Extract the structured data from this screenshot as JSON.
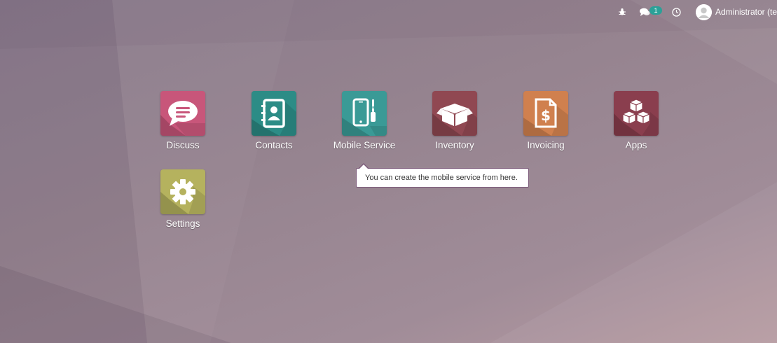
{
  "topbar": {
    "debug_icon": "bug-icon",
    "chat_icon": "chat-icon",
    "chat_badge": "1",
    "activity_icon": "clock-icon",
    "user_name": "Administrator (te"
  },
  "apps": [
    {
      "label": "Discuss",
      "icon": "chat-bubble-icon",
      "color": "#c8567a"
    },
    {
      "label": "Contacts",
      "icon": "address-book-icon",
      "color": "#2c8c86"
    },
    {
      "label": "Mobile Service",
      "icon": "mobile-phone-icon",
      "color": "#3a9a96"
    },
    {
      "label": "Inventory",
      "icon": "box-icon",
      "color": "#904852"
    },
    {
      "label": "Invoicing",
      "icon": "invoice-icon",
      "color": "#d0804e"
    },
    {
      "label": "Apps",
      "icon": "cubes-icon",
      "color": "#8a3e4e"
    },
    {
      "label": "Settings",
      "icon": "gear-icon",
      "color": "#b5b25e"
    }
  ],
  "tooltip": {
    "text": "You can create the mobile service from here."
  }
}
